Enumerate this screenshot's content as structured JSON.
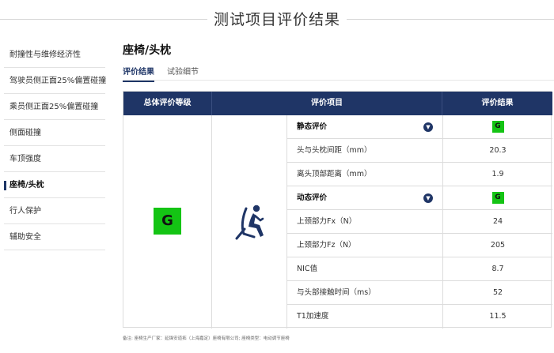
{
  "page": {
    "title": "测试项目评价结果"
  },
  "sidebar": {
    "items": [
      {
        "label": "耐撞性与维修经济性",
        "active": false
      },
      {
        "label": "驾驶员侧正面25%偏置碰撞",
        "active": false
      },
      {
        "label": "乘员侧正面25%偏置碰撞",
        "active": false
      },
      {
        "label": "侧面碰撞",
        "active": false
      },
      {
        "label": "车顶强度",
        "active": false
      },
      {
        "label": "座椅/头枕",
        "active": true
      },
      {
        "label": "行人保护",
        "active": false
      },
      {
        "label": "辅助安全",
        "active": false
      }
    ]
  },
  "section": {
    "title": "座椅/头枕"
  },
  "tabs": [
    {
      "label": "评价结果",
      "active": true
    },
    {
      "label": "试验细节",
      "active": false
    }
  ],
  "table": {
    "headers": [
      "总体评价等级",
      "评价项目",
      "评价结果"
    ],
    "overall_grade": "G",
    "grade_color": "#14c414",
    "header_bg": "#1f3566",
    "icon": "seated-person-icon",
    "rows": [
      {
        "name": "静态评价",
        "value": "G",
        "type": "header"
      },
      {
        "name": "头与头枕间距（mm）",
        "value": "20.3",
        "type": "item"
      },
      {
        "name": "离头顶部距离（mm）",
        "value": "1.9",
        "type": "item"
      },
      {
        "name": "动态评价",
        "value": "G",
        "type": "header"
      },
      {
        "name": "上颈部力Fx（N）",
        "value": "24",
        "type": "item"
      },
      {
        "name": "上颈部力Fz（N）",
        "value": "205",
        "type": "item"
      },
      {
        "name": "NIC值",
        "value": "8.7",
        "type": "item"
      },
      {
        "name": "与头部接触时间（ms）",
        "value": "52",
        "type": "item"
      },
      {
        "name": "T1加速度",
        "value": "11.5",
        "type": "item"
      }
    ]
  },
  "footnote": "备注: 座椅生产厂家：延锋安道拓（上海嘉定）座椅有限公司; 座椅类型：电动调节座椅"
}
